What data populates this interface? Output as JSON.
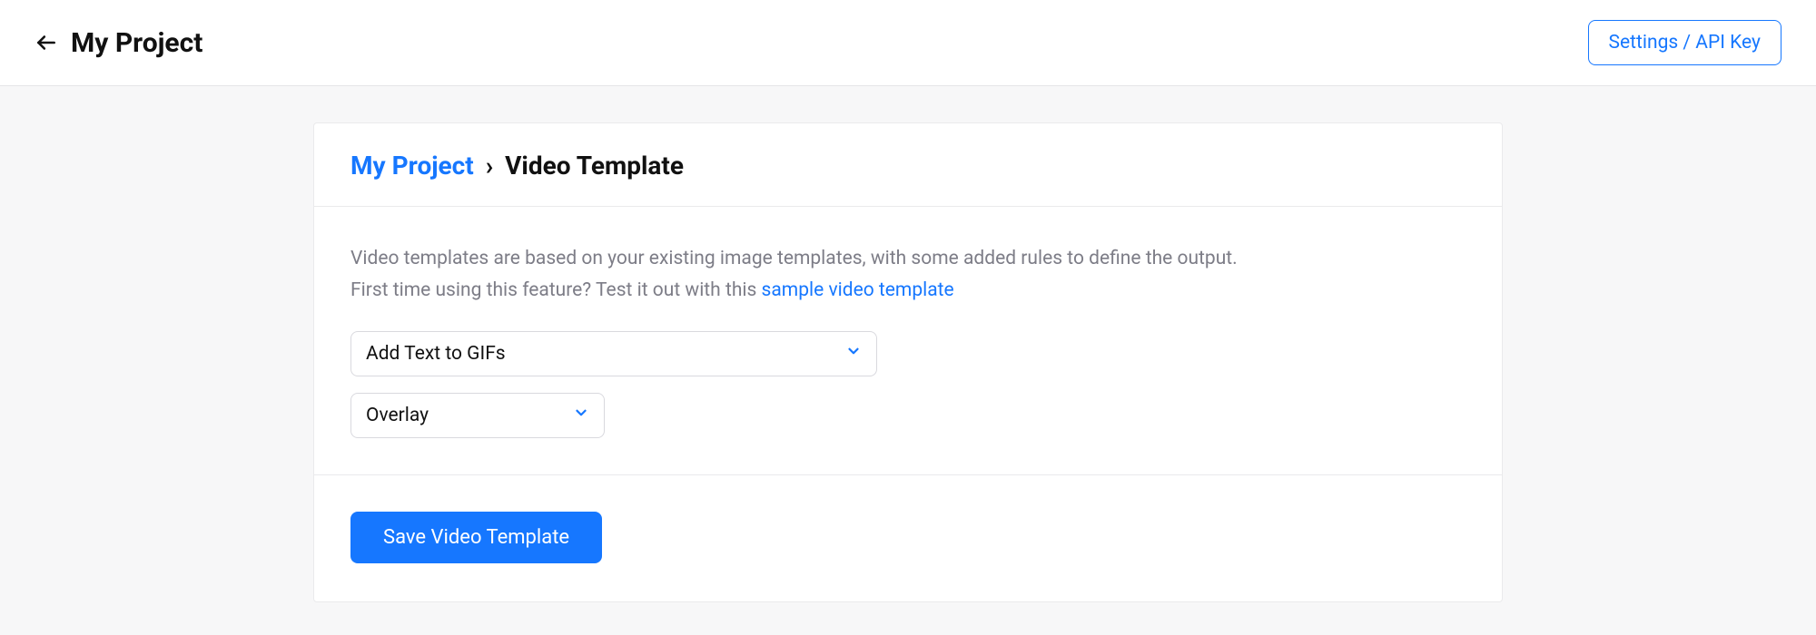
{
  "topbar": {
    "title": "My Project",
    "settings_label": "Settings / API Key"
  },
  "breadcrumb": {
    "root": "My Project",
    "separator": "›",
    "current": "Video Template"
  },
  "help": {
    "line1": "Video templates are based on your existing image templates, with some added rules to define the output.",
    "line2_prefix": "First time using this feature? Test it out with this ",
    "sample_link": "sample video template"
  },
  "form": {
    "template_select": "Add Text to GIFs",
    "mode_select": "Overlay"
  },
  "actions": {
    "save_label": "Save Video Template"
  },
  "colors": {
    "primary": "#1677ff",
    "muted": "#7d7d87",
    "border": "#eaeaec",
    "panel_bg": "#f7f7f8"
  }
}
